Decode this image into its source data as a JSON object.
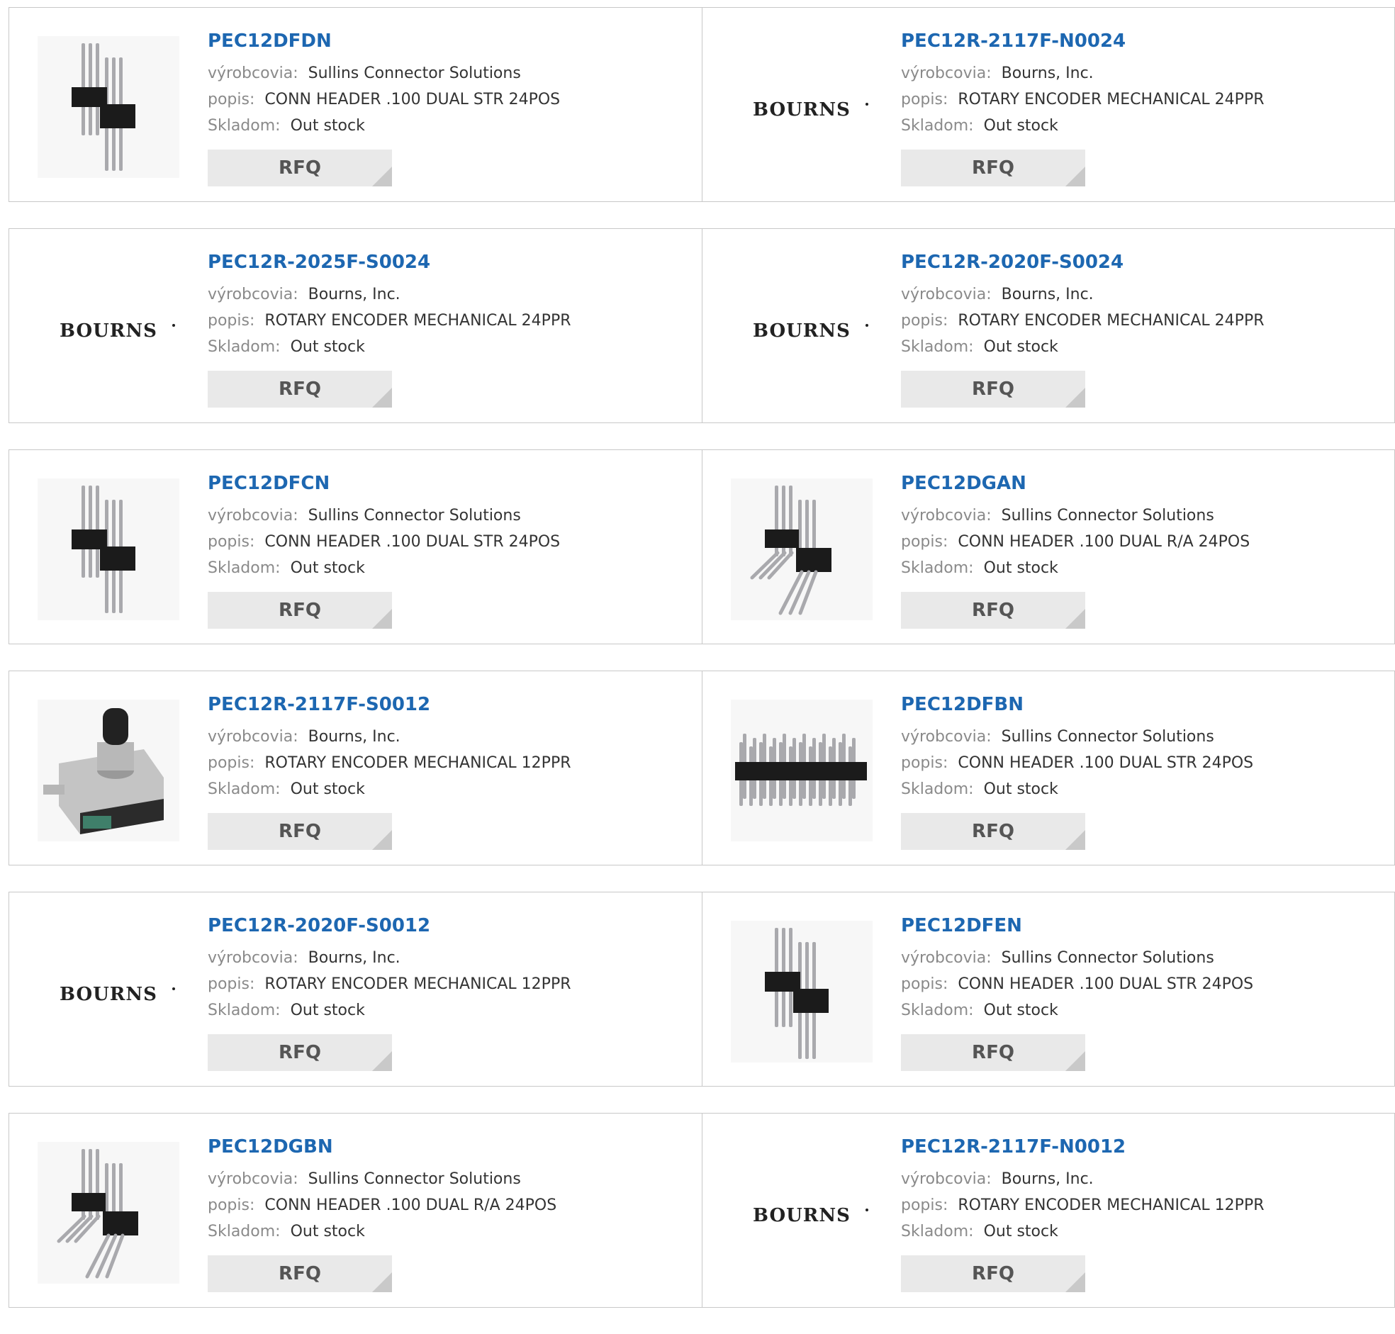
{
  "labels": {
    "manufacturer": "výrobcovia:",
    "description": "popis:",
    "stock": "Skladom:"
  },
  "rfq_label": "RFQ",
  "brand_text": "BOURNS",
  "colors": {
    "part_link": "#1d67b1",
    "label": "#8a8a8a",
    "rfq_bg": "#e9e9e9",
    "border": "#c8c8c8"
  },
  "products": [
    {
      "part": "PEC12DFDN",
      "manufacturer": "Sullins Connector Solutions",
      "description": "CONN HEADER .100 DUAL STR 24POS",
      "stock": "Out stock",
      "image": "header-straight"
    },
    {
      "part": "PEC12R-2117F-N0024",
      "manufacturer": "Bourns, Inc.",
      "description": "ROTARY ENCODER MECHANICAL 24PPR",
      "stock": "Out stock",
      "image": "bourns-logo"
    },
    {
      "part": "PEC12R-2025F-S0024",
      "manufacturer": "Bourns, Inc.",
      "description": "ROTARY ENCODER MECHANICAL 24PPR",
      "stock": "Out stock",
      "image": "bourns-logo"
    },
    {
      "part": "PEC12R-2020F-S0024",
      "manufacturer": "Bourns, Inc.",
      "description": "ROTARY ENCODER MECHANICAL 24PPR",
      "stock": "Out stock",
      "image": "bourns-logo"
    },
    {
      "part": "PEC12DFCN",
      "manufacturer": "Sullins Connector Solutions",
      "description": "CONN HEADER .100 DUAL STR 24POS",
      "stock": "Out stock",
      "image": "header-straight"
    },
    {
      "part": "PEC12DGAN",
      "manufacturer": "Sullins Connector Solutions",
      "description": "CONN HEADER .100 DUAL R/A 24POS",
      "stock": "Out stock",
      "image": "header-right-angle"
    },
    {
      "part": "PEC12R-2117F-S0012",
      "manufacturer": "Bourns, Inc.",
      "description": "ROTARY ENCODER MECHANICAL 12PPR",
      "stock": "Out stock",
      "image": "rotary-encoder"
    },
    {
      "part": "PEC12DFBN",
      "manufacturer": "Sullins Connector Solutions",
      "description": "CONN HEADER .100 DUAL STR 24POS",
      "stock": "Out stock",
      "image": "header-long-strip"
    },
    {
      "part": "PEC12R-2020F-S0012",
      "manufacturer": "Bourns, Inc.",
      "description": "ROTARY ENCODER MECHANICAL 12PPR",
      "stock": "Out stock",
      "image": "bourns-logo"
    },
    {
      "part": "PEC12DFEN",
      "manufacturer": "Sullins Connector Solutions",
      "description": "CONN HEADER .100 DUAL STR 24POS",
      "stock": "Out stock",
      "image": "header-straight-tall"
    },
    {
      "part": "PEC12DGBN",
      "manufacturer": "Sullins Connector Solutions",
      "description": "CONN HEADER .100 DUAL R/A 24POS",
      "stock": "Out stock",
      "image": "header-right-angle"
    },
    {
      "part": "PEC12R-2117F-N0012",
      "manufacturer": "Bourns, Inc.",
      "description": "ROTARY ENCODER MECHANICAL 12PPR",
      "stock": "Out stock",
      "image": "bourns-logo"
    }
  ]
}
